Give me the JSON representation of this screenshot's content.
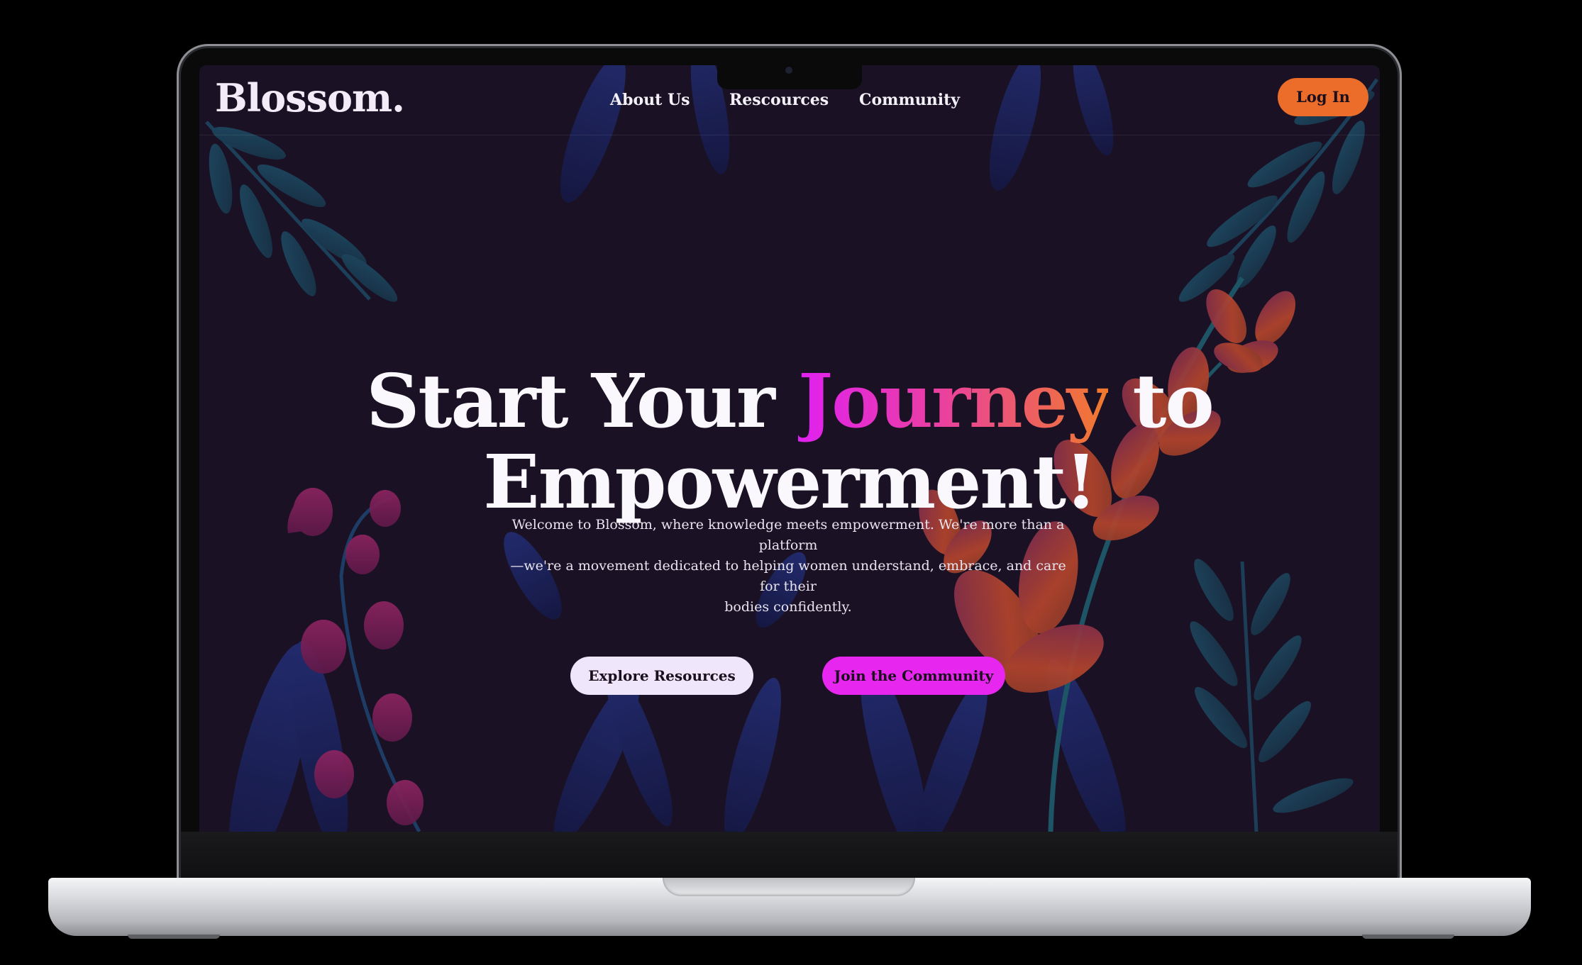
{
  "brand": {
    "logo": "Blossom."
  },
  "nav": {
    "about": "About Us",
    "resources": "Rescources",
    "community": "Community",
    "login": "Log In"
  },
  "hero": {
    "title_start": "Start Your",
    "title_highlight": "Journey",
    "title_end": "to",
    "title_line2": "Empowerment!",
    "intro_line1": "Welcome to Blossom, where knowledge meets empowerment. We're more than a platform",
    "intro_line2": "—we're a movement dedicated to helping women understand, embrace, and care for their",
    "intro_line3": "bodies confidently."
  },
  "actions": {
    "explore": "Explore Resources",
    "join": "Join the Community"
  },
  "colors": {
    "background": "#1a1224",
    "accent_orange": "#ec6d29",
    "accent_pink": "#e726ef",
    "button_light": "#efe6fb"
  }
}
